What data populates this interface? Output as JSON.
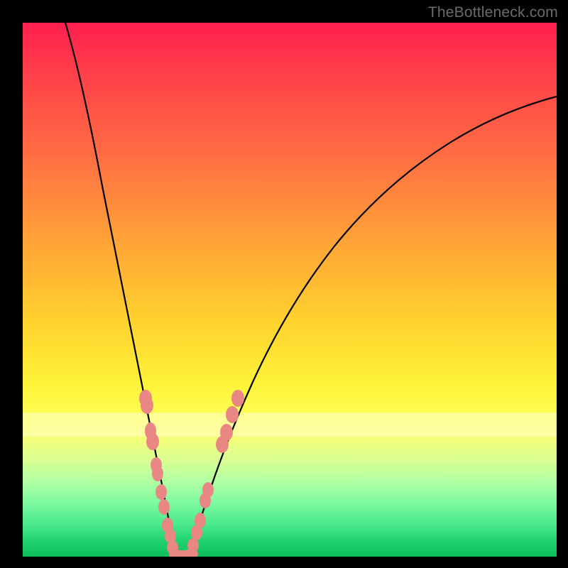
{
  "watermark": {
    "text": "TheBottleneck.com"
  },
  "colors": {
    "blob": "#e98784",
    "curve": "#000000",
    "frame": "#000000"
  },
  "chart_data": {
    "type": "line",
    "title": "",
    "xlabel": "",
    "ylabel": "",
    "xlim": [
      0,
      100
    ],
    "ylim": [
      0,
      100
    ],
    "note": "No numeric axes visible; values are estimated normalized coordinates (0–100) read from the plotted curves.",
    "series": [
      {
        "name": "left-curve",
        "x": [
          8,
          10,
          12,
          14,
          16,
          18,
          20,
          22,
          23.5,
          25,
          26,
          27,
          27.5,
          28,
          28.5
        ],
        "y": [
          100,
          88,
          76,
          64,
          52,
          41,
          31,
          22,
          16,
          11,
          7,
          4,
          2,
          1,
          0
        ]
      },
      {
        "name": "right-curve",
        "x": [
          31,
          32,
          33,
          35,
          38,
          42,
          47,
          53,
          60,
          68,
          77,
          86,
          95,
          100
        ],
        "y": [
          0,
          2,
          5,
          10,
          18,
          27,
          37,
          47,
          56,
          64,
          72,
          78,
          83,
          86
        ]
      }
    ],
    "markers": {
      "name": "salmon-blobs",
      "points": [
        {
          "x": 23.0,
          "y": 29.7
        },
        {
          "x": 23.2,
          "y": 28.3
        },
        {
          "x": 24.0,
          "y": 23.5
        },
        {
          "x": 24.3,
          "y": 21.5
        },
        {
          "x": 25.0,
          "y": 17.2
        },
        {
          "x": 25.3,
          "y": 15.6
        },
        {
          "x": 25.9,
          "y": 12.1
        },
        {
          "x": 26.5,
          "y": 9.3
        },
        {
          "x": 27.2,
          "y": 5.8
        },
        {
          "x": 27.6,
          "y": 3.9
        },
        {
          "x": 28.1,
          "y": 1.7
        },
        {
          "x": 28.8,
          "y": 0.4
        },
        {
          "x": 29.7,
          "y": 0.3
        },
        {
          "x": 30.6,
          "y": 0.3
        },
        {
          "x": 31.5,
          "y": 0.5
        },
        {
          "x": 31.9,
          "y": 2.1
        },
        {
          "x": 32.6,
          "y": 4.5
        },
        {
          "x": 33.2,
          "y": 6.8
        },
        {
          "x": 34.2,
          "y": 10.5
        },
        {
          "x": 34.7,
          "y": 12.5
        },
        {
          "x": 37.4,
          "y": 21.0
        },
        {
          "x": 38.1,
          "y": 23.3
        },
        {
          "x": 39.2,
          "y": 26.6
        },
        {
          "x": 40.3,
          "y": 29.6
        }
      ]
    },
    "bands": [
      {
        "name": "pale-yellow-band",
        "y_from": 22.5,
        "y_to": 27.0
      }
    ]
  }
}
